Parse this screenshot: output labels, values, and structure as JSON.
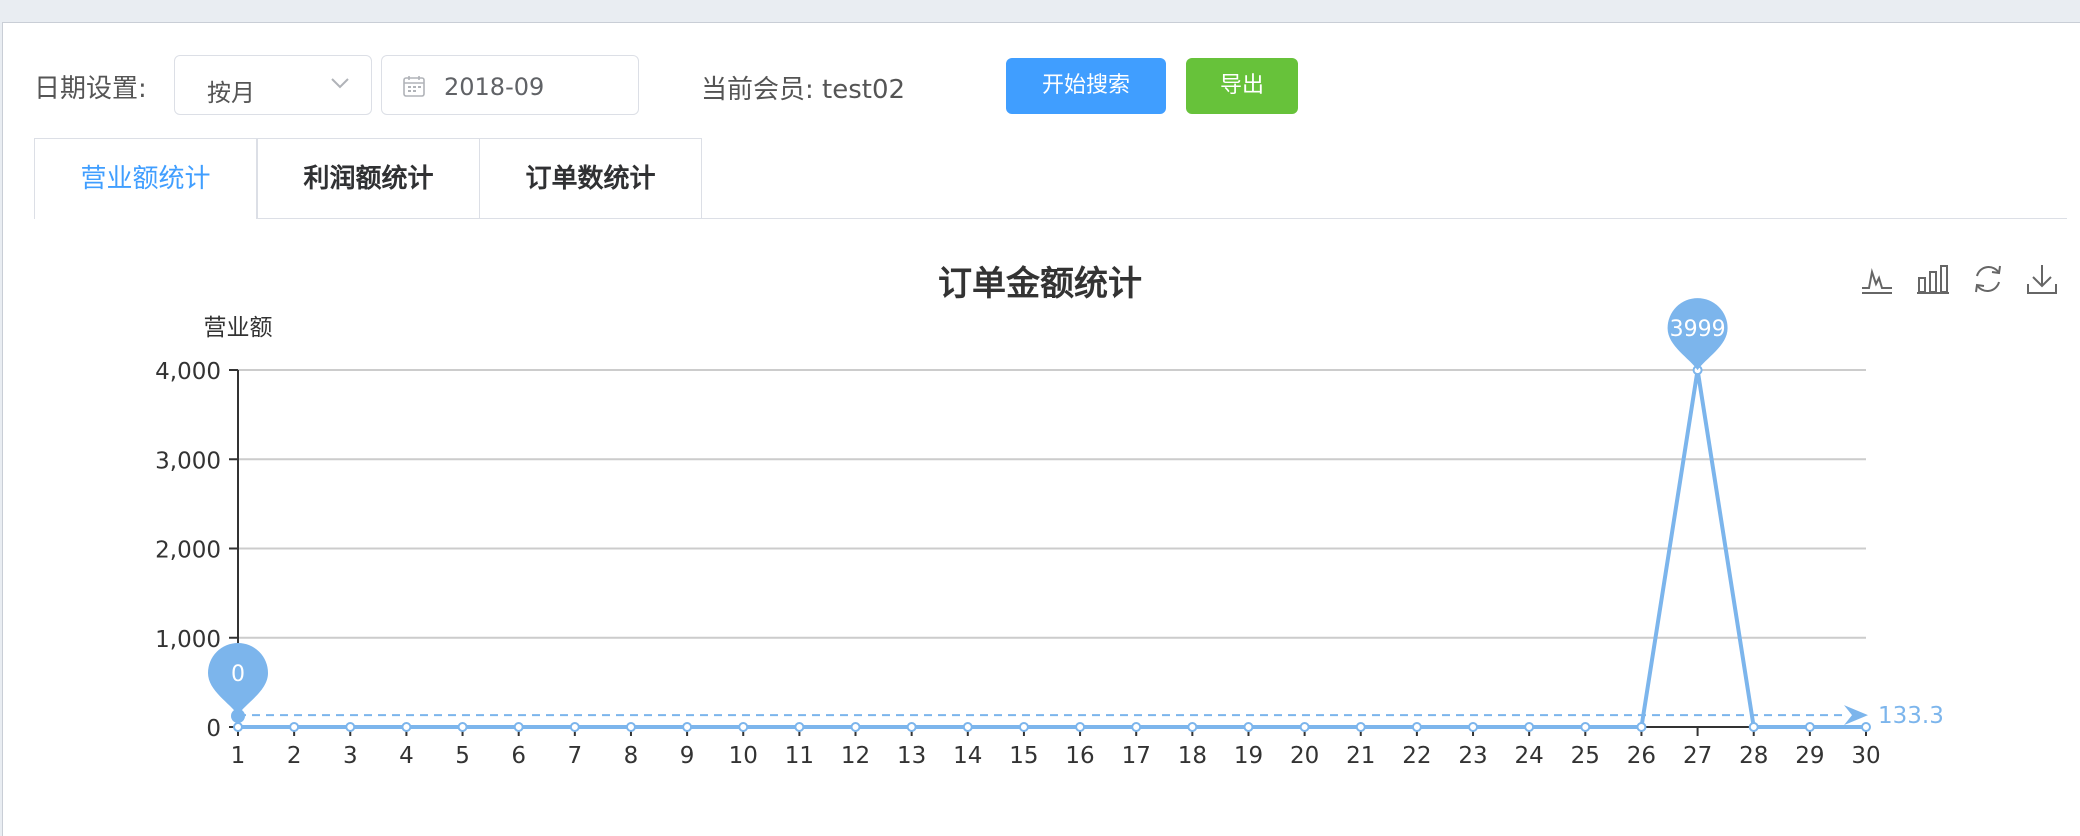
{
  "filters": {
    "date_label": "日期设置:",
    "period_value": "按月",
    "date_value": "2018-09",
    "member_text": "当前会员: test02",
    "search_button": "开始搜索",
    "export_button": "导出"
  },
  "tabs": [
    "营业额统计",
    "利润额统计",
    "订单数统计"
  ],
  "toolbox": [
    "line-chart-icon",
    "bar-chart-icon",
    "refresh-icon",
    "download-icon"
  ],
  "colors": {
    "series": "#7cb5ec",
    "primary": "#409eff",
    "success": "#67c23a"
  },
  "chart_data": {
    "type": "line",
    "title": "订单金额统计",
    "ylabel": "营业额",
    "xlabel": "",
    "x": [
      1,
      2,
      3,
      4,
      5,
      6,
      7,
      8,
      9,
      10,
      11,
      12,
      13,
      14,
      15,
      16,
      17,
      18,
      19,
      20,
      21,
      22,
      23,
      24,
      25,
      26,
      27,
      28,
      29,
      30
    ],
    "series": [
      {
        "values": [
          0,
          0,
          0,
          0,
          0,
          0,
          0,
          0,
          0,
          0,
          0,
          0,
          0,
          0,
          0,
          0,
          0,
          0,
          0,
          0,
          0,
          0,
          0,
          0,
          0,
          0,
          3999,
          0,
          0,
          0
        ]
      }
    ],
    "ylim": [
      0,
      4000
    ],
    "yticks": [
      "0",
      "1,000",
      "2,000",
      "3,000",
      "4,000"
    ],
    "markpoints": [
      {
        "label": "3999",
        "x": 27
      },
      {
        "label": "0",
        "x": 1
      }
    ],
    "markline": {
      "label": "133.3",
      "value": 133.3
    },
    "grid": true
  }
}
